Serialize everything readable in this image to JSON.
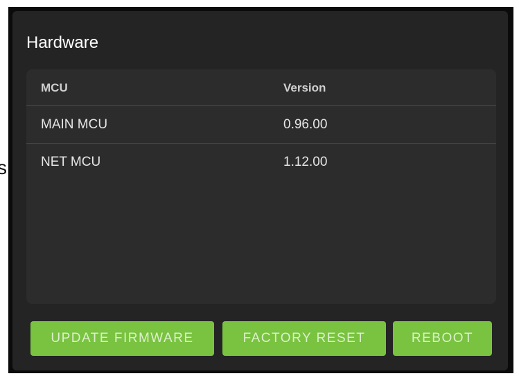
{
  "edge_text": "s",
  "panel": {
    "title": "Hardware"
  },
  "table": {
    "columns": [
      "MCU",
      "Version"
    ],
    "rows": [
      {
        "mcu": "MAIN MCU",
        "version": "0.96.00"
      },
      {
        "mcu": "NET MCU",
        "version": "1.12.00"
      }
    ]
  },
  "actions": {
    "update_firmware": "UPDATE FIRMWARE",
    "factory_reset": "FACTORY RESET",
    "reboot": "REBOOT"
  },
  "colors": {
    "panel_background": "#242424",
    "table_background": "#2c2c2c",
    "button_accent": "#79c340"
  }
}
